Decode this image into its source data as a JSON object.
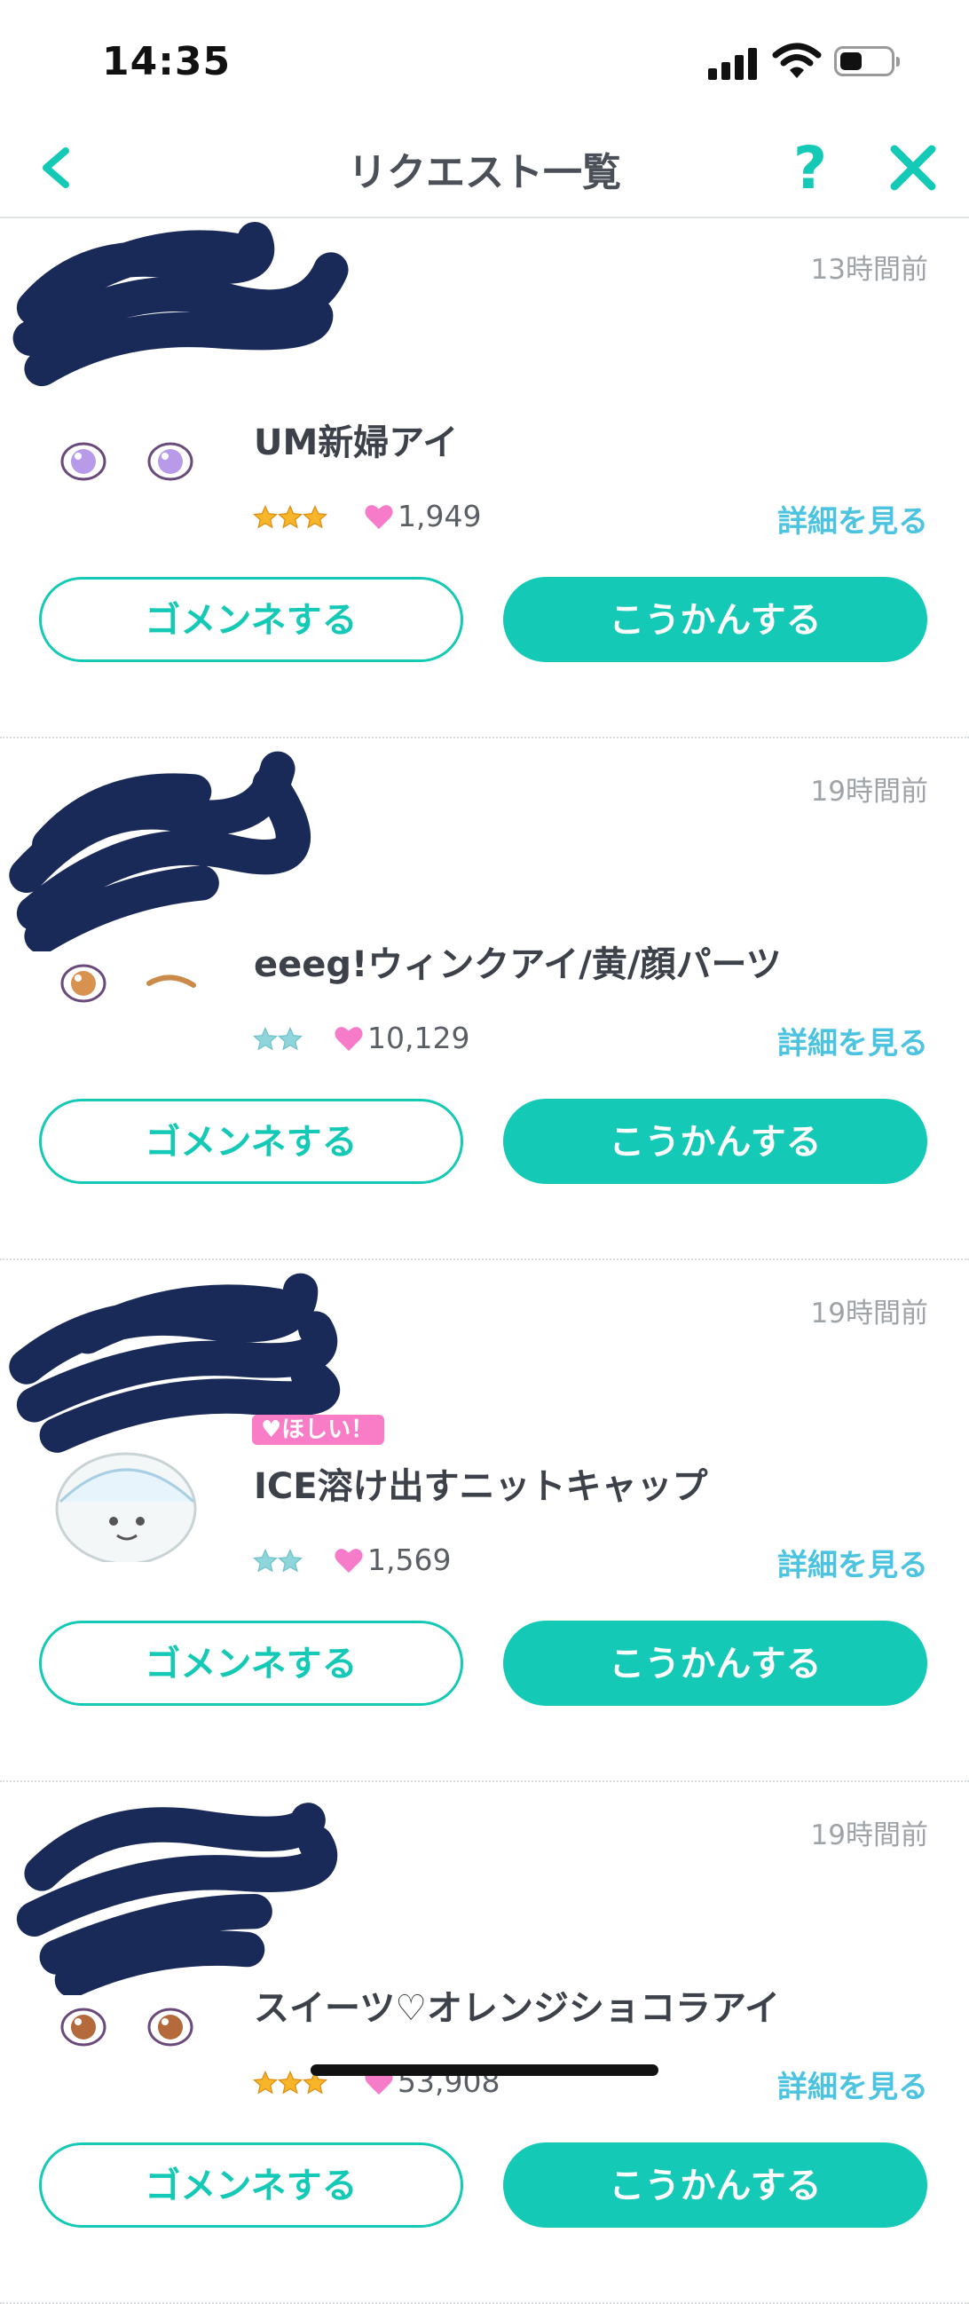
{
  "status_bar": {
    "time": "14:35"
  },
  "header": {
    "title": "リクエスト一覧",
    "help_symbol": "?"
  },
  "colors": {
    "accent": "#14c9b5",
    "link": "#4cc3e0",
    "badge": "#f97cc7",
    "heart": "#f67cc9",
    "star_gold": "#f7b52a",
    "star_teal": "#8fd6dc"
  },
  "requests": [
    {
      "time_ago": "13時間前",
      "item_name": "UM新婦アイ",
      "badge": "",
      "rarity": 3,
      "rarity_color": "gold",
      "likes": "1,949",
      "detail_label": "詳細を見る",
      "decline_label": "ゴメンネする",
      "accept_label": "こうかんする",
      "thumb_icon": "purple-eyes-icon"
    },
    {
      "time_ago": "19時間前",
      "item_name": "eeeg!ウィンクアイ/黄/顔パーツ",
      "badge": "",
      "rarity": 2,
      "rarity_color": "teal",
      "likes": "10,129",
      "detail_label": "詳細を見る",
      "decline_label": "ゴメンネする",
      "accept_label": "こうかんする",
      "thumb_icon": "wink-eyes-icon"
    },
    {
      "time_ago": "19時間前",
      "item_name": "ICE溶け出すニットキャップ",
      "badge": "♥ほしい！",
      "rarity": 2,
      "rarity_color": "teal",
      "likes": "1,569",
      "detail_label": "詳細を見る",
      "decline_label": "ゴメンネする",
      "accept_label": "こうかんする",
      "thumb_icon": "knit-cap-icon"
    },
    {
      "time_ago": "19時間前",
      "item_name": "スイーツ♡オレンジショコラアイ",
      "badge": "",
      "rarity": 3,
      "rarity_color": "gold",
      "likes": "53,908",
      "detail_label": "詳細を見る",
      "decline_label": "ゴメンネする",
      "accept_label": "こうかんする",
      "thumb_icon": "orange-eyes-icon"
    }
  ]
}
